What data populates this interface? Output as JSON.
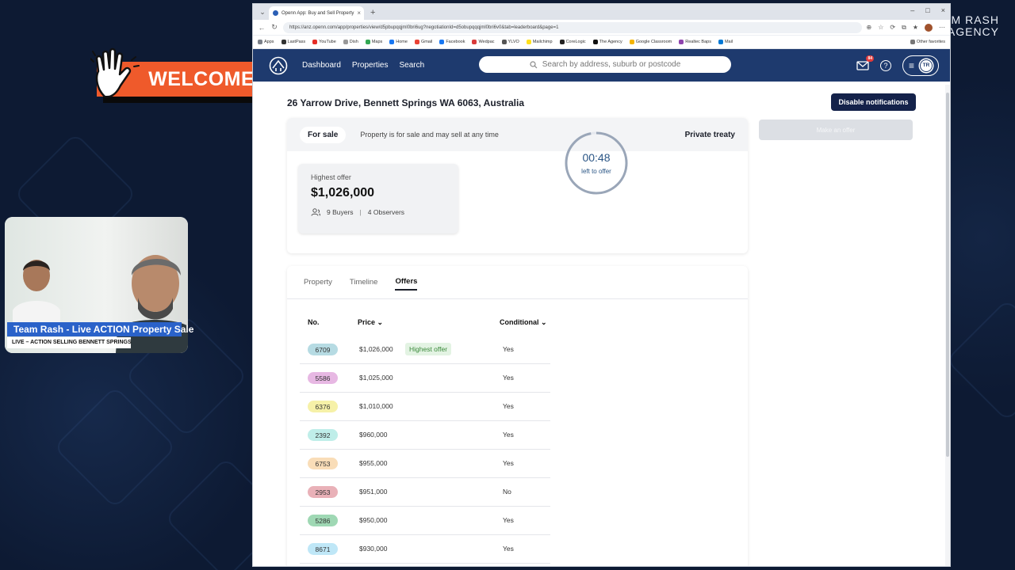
{
  "overlay": {
    "welcome_text": "WELCOME!",
    "lower_third_title": "Team Rash - Live ACTION Property Sale",
    "lower_third_subtitle": "LIVE – ACTION SELLING BENNETT SPRINGS",
    "brand_line1": "TEAM RASH",
    "brand_line2": "AGENCY"
  },
  "browser": {
    "tab_title": "Openn App: Buy and Sell Property",
    "url": "https://anz.openn.com/app/properties/view/d5pbupqqjml0bri6ug?negotiationId=d5obupqqqjml0bri6v0&tab=leaderboard&page=1",
    "bookmarks": [
      {
        "label": "Apps",
        "color": "#7a7f88"
      },
      {
        "label": "LastPass",
        "color": "#333333"
      },
      {
        "label": "YouTube",
        "color": "#e52d27"
      },
      {
        "label": "Dish",
        "color": "#999999"
      },
      {
        "label": "Maps",
        "color": "#34a853"
      },
      {
        "label": "Home",
        "color": "#1877f2"
      },
      {
        "label": "Gmail",
        "color": "#ea4335"
      },
      {
        "label": "Facebook",
        "color": "#1877f2"
      },
      {
        "label": "Wedpac",
        "color": "#d83a3a"
      },
      {
        "label": "YLVO",
        "color": "#555555"
      },
      {
        "label": "Mailchimp",
        "color": "#ffe01b"
      },
      {
        "label": "CoreLogic",
        "color": "#222222"
      },
      {
        "label": "The Agency",
        "color": "#111111"
      },
      {
        "label": "Google Classroom",
        "color": "#f4b400"
      },
      {
        "label": "Realtec Baps",
        "color": "#8e44ad"
      },
      {
        "label": "Mail",
        "color": "#0078d4"
      },
      {
        "label": "Other favorites",
        "color": "#777777"
      }
    ]
  },
  "app": {
    "nav": [
      "Dashboard",
      "Properties",
      "Search"
    ],
    "search_placeholder": "Search by address, suburb or postcode",
    "mail_badge": "84",
    "avatar_initials": "TR"
  },
  "property": {
    "address": "26 Yarrow Drive, Bennett Springs WA 6063, Australia",
    "disable_notifications": "Disable notifications",
    "make_offer": "Make an offer",
    "status": "For sale",
    "status_desc": "Property is for sale and may sell at any time",
    "method": "Private treaty",
    "highest_offer_label": "Highest offer",
    "highest_offer_amount": "$1,026,000",
    "buyers": "9 Buyers",
    "observers": "4 Observers",
    "timer_time": "00:48",
    "timer_label": "left to offer",
    "timer_progress": 0.97
  },
  "tabs": [
    {
      "label": "Property",
      "active": false
    },
    {
      "label": "Timeline",
      "active": false
    },
    {
      "label": "Offers",
      "active": true
    }
  ],
  "offers_table": {
    "headers": {
      "no": "No.",
      "price": "Price",
      "conditional": "Conditional"
    },
    "highest_badge": "Highest offer",
    "rows": [
      {
        "no": "6709",
        "price": "$1,026,000",
        "conditional": "Yes",
        "color": "#b6dbe3",
        "highest": true
      },
      {
        "no": "5586",
        "price": "$1,025,000",
        "conditional": "Yes",
        "color": "#e7b8e3"
      },
      {
        "no": "6376",
        "price": "$1,010,000",
        "conditional": "Yes",
        "color": "#f6f1a8"
      },
      {
        "no": "2392",
        "price": "$960,000",
        "conditional": "Yes",
        "color": "#bfeee9"
      },
      {
        "no": "6753",
        "price": "$955,000",
        "conditional": "Yes",
        "color": "#f9ddb8"
      },
      {
        "no": "2953",
        "price": "$951,000",
        "conditional": "No",
        "color": "#e9b1b8"
      },
      {
        "no": "5286",
        "price": "$950,000",
        "conditional": "Yes",
        "color": "#9fd8b4"
      },
      {
        "no": "8671",
        "price": "$930,000",
        "conditional": "Yes",
        "color": "#bfe7f7"
      }
    ]
  }
}
